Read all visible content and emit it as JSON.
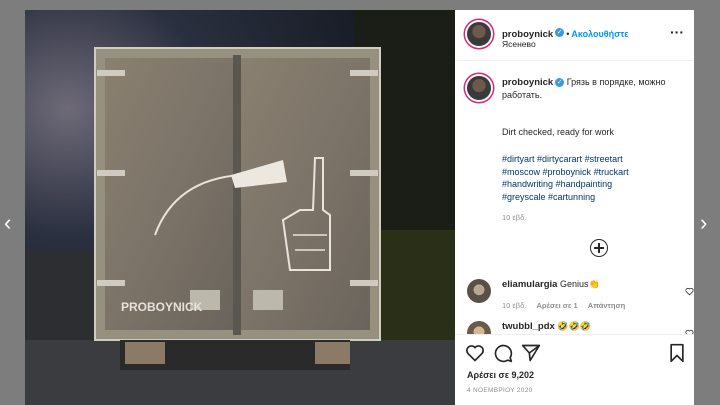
{
  "post": {
    "username": "proboynick",
    "follow_label": "Ακολουθήστε",
    "location": "Ясенево",
    "caption_line1": "Грязь в порядке, можно работать.",
    "caption_line2": "Dirt checked, ready for work",
    "hashtags": [
      "#dirtyart",
      "#dirtycarart",
      "#streetart",
      "#moscow",
      "#proboynick",
      "#truckart",
      "#handwriting",
      "#handpainting",
      "#greyscale",
      "#cartunning"
    ],
    "caption_time": "10 εβδ.",
    "truck_text": "PROBOYNICK",
    "likes": "Αρέσει σε 9,202",
    "date": "4 ΝΟΕΜΒΡΙΟΥ 2020"
  },
  "comments": [
    {
      "user": "eliamulargia",
      "text": "Genius👏",
      "time": "10 εβδ.",
      "likes": "Αρέσει σε 1",
      "reply": "Απάντηση"
    },
    {
      "user": "twubbl_pdx",
      "text": "🤣🤣🤣"
    }
  ],
  "icons": {
    "nav_prev": "chevron-left-icon",
    "nav_next": "chevron-right-icon",
    "more": "more-options-icon",
    "load_more": "plus-circle-icon",
    "like": "heart-icon",
    "comment": "comment-icon",
    "share": "share-icon",
    "save": "bookmark-icon",
    "verified": "verified-badge-icon"
  },
  "colors": {
    "link": "#00376b",
    "follow": "#0095f6",
    "verified": "#3897f0"
  }
}
